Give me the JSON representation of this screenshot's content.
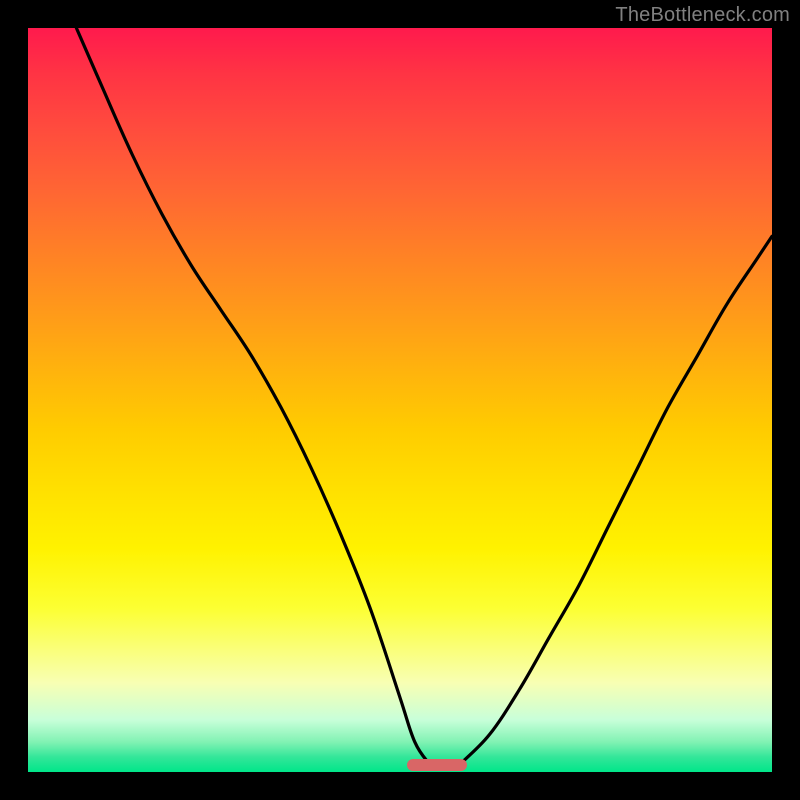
{
  "watermark": "TheBottleneck.com",
  "colors": {
    "frame": "#000000",
    "curve_stroke": "#000000",
    "bar_fill": "#d96666"
  },
  "chart_data": {
    "type": "line",
    "title": "",
    "xlabel": "",
    "ylabel": "",
    "xlim": [
      0,
      100
    ],
    "ylim": [
      0,
      100
    ],
    "grid": false,
    "legend": false,
    "note": "Values estimated from pixel positions (no axis ticks shown). y is bottleneck-like metric (0 at bottom, 100 at top). Minimum around x≈54.",
    "series": [
      {
        "name": "left-branch",
        "x": [
          6.5,
          10,
          14,
          18,
          22,
          26,
          30,
          34,
          38,
          42,
          46,
          50,
          52,
          54
        ],
        "y": [
          100,
          92,
          83,
          75,
          68,
          62,
          56,
          49,
          41,
          32,
          22,
          10,
          4,
          1
        ]
      },
      {
        "name": "right-branch",
        "x": [
          58,
          62,
          66,
          70,
          74,
          78,
          82,
          86,
          90,
          94,
          98,
          100
        ],
        "y": [
          1,
          5,
          11,
          18,
          25,
          33,
          41,
          49,
          56,
          63,
          69,
          72
        ]
      }
    ],
    "optimal_marker": {
      "x_start": 51,
      "x_end": 59,
      "y": 1
    }
  }
}
